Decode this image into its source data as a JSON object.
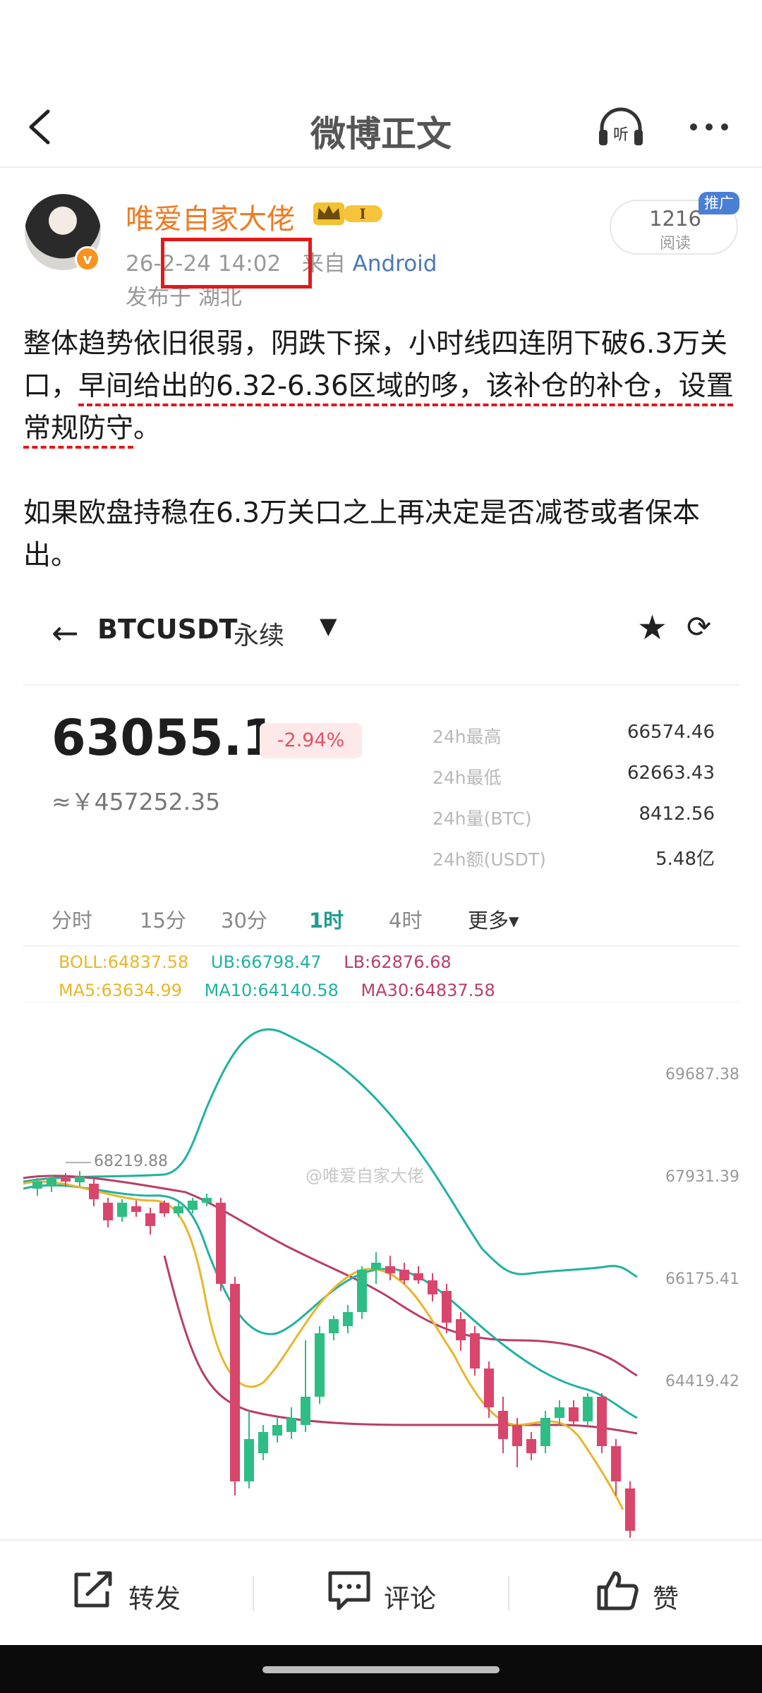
{
  "header": {
    "title": "微博正文",
    "listen_label": "听"
  },
  "author": {
    "name": "唯爱自家大佬",
    "level_badge": "I",
    "timestamp": "26-2-24 14:02",
    "source_prefix": "来自",
    "source": "Android",
    "location": "发布于 湖北"
  },
  "read_count": {
    "count": "1216",
    "label": "阅读",
    "ad_tag": "推广"
  },
  "post": {
    "p1_before": "整体趋势依旧很弱，阴跌下探，小时线四连阴下破6.3万关口，",
    "p1_underlined": "早间给出的6.32-6.36区域的哆，该补仓的补仓，设置常规防守",
    "p1_after": "。",
    "p2": "如果欧盘持稳在6.3万关口之上再决定是否减苍或者保本出。"
  },
  "embedded": {
    "back_icon": "←",
    "pair": "BTCUSDT",
    "contract": "永续",
    "price": "63055.1",
    "change": "-2.94%",
    "cny": "≈￥457252.35",
    "stats": [
      {
        "k": "24h最高",
        "v": "66574.46"
      },
      {
        "k": "24h最低",
        "v": "62663.43"
      },
      {
        "k": "24h量(BTC)",
        "v": "8412.56"
      },
      {
        "k": "24h额(USDT)",
        "v": "5.48亿"
      }
    ],
    "tabs": [
      "分时",
      "15分",
      "30分",
      "1时",
      "4时",
      "更多▾"
    ],
    "active_tab": "1时",
    "legend": {
      "boll": "BOLL:64837.58",
      "ub": "UB:66798.47",
      "lb": "LB:62876.68",
      "ma5": "MA5:63634.99",
      "ma10": "MA10:64140.58",
      "ma30": "MA30:64837.58"
    },
    "watermark": "@唯爱自家大佬",
    "price_marker": "68219.88",
    "y_ticks": [
      "69687.38",
      "67931.39",
      "66175.41",
      "64419.42"
    ],
    "colors": {
      "up": "#2ebd85",
      "down": "#d9466b",
      "ub": "#20b2a0",
      "lb": "#b83f66",
      "ma5": "#e8b62a"
    }
  },
  "actions": {
    "repost": "转发",
    "comment": "评论",
    "like": "赞"
  }
}
